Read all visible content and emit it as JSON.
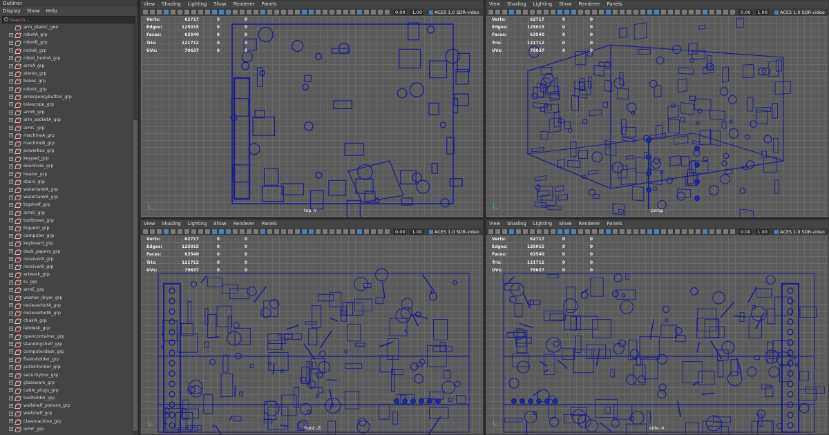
{
  "outliner": {
    "title": "Outliner",
    "menu": [
      "Display",
      "Show",
      "Help"
    ],
    "search_placeholder": "Search...",
    "items": [
      "arm_plainC_geo",
      "robotA_grp",
      "robotB_grp",
      "rocket_grp",
      "robot_helmA_grp",
      "armA_grp",
      "stereo_grp",
      "boxes_grp",
      "robotc_grp",
      "emergencybutton_grp",
      "telescope_grp",
      "armB_grp",
      "arm_socketA_grp",
      "armC_grp",
      "machineA_grp",
      "machineB_grp",
      "powerbox_grp",
      "keypad_grp",
      "doorknob_grp",
      "heater_grp",
      "stairs_grp",
      "watertankA_grp",
      "watertankB_grp",
      "bigshelf_grp",
      "armD_grp",
      "toolboxes_grp",
      "bigvent_grp",
      "computer_grp",
      "keyboard_grp",
      "desk_papers_grp",
      "receiverA_grp",
      "receiverB_grp",
      "artwork_grp",
      "tv_grp",
      "armE_grp",
      "washer_dryer_grp",
      "recieverbotA_grp",
      "recieverbotB_grp",
      "chairA_grp",
      "labdesk_grp",
      "opencontainer_grp",
      "standingshelf_grp",
      "computerdesk_grp",
      "flasksholder_grp",
      "potionholder_grp",
      "securitybox_grp",
      "glassware_grp",
      "cable_plugs_grp",
      "toolholder_grp",
      "wallshelf_potions_grp",
      "wallshelf_grp",
      "clawmachine_grp",
      "armF_grp"
    ]
  },
  "viewport_menu": [
    "View",
    "Shading",
    "Lighting",
    "Show",
    "Renderer",
    "Panels"
  ],
  "toolbar": {
    "exposure": "0.00",
    "gamma": "1.00",
    "color_space": "ACES 1.0 SDR-video"
  },
  "hud": {
    "labels": [
      "Verts:",
      "Edges:",
      "Faces:",
      "Tris:",
      "UVs:"
    ],
    "values": [
      "62717",
      "125015",
      "63540",
      "121712",
      "79637"
    ],
    "sel": [
      "0",
      "0",
      "0",
      "0",
      "0"
    ],
    "comp": [
      "0",
      "0",
      "0",
      "0",
      "0"
    ]
  },
  "viewports": {
    "top": {
      "camera": "top -Y"
    },
    "persp": {
      "camera": "persp"
    },
    "front": {
      "camera": "front -Z"
    },
    "side": {
      "camera": "side -X"
    }
  },
  "colors": {
    "wire": "#1a1f8c",
    "grid": "#6a6a6a",
    "bg": "#5b5b5b"
  }
}
